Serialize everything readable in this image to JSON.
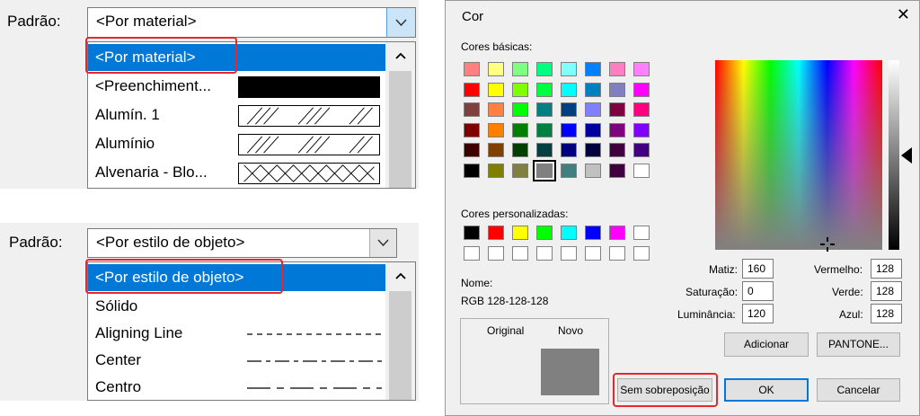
{
  "panel1": {
    "label": "Padrão:",
    "combo_value": "<Por material>",
    "items": [
      {
        "text": "<Por material>",
        "pattern": "none",
        "selected": true
      },
      {
        "text": "<Preenchiment...",
        "pattern": "solid"
      },
      {
        "text": "Alumín. 1",
        "pattern": "diagonal-hatch"
      },
      {
        "text": "Alumínio",
        "pattern": "diagonal-hatch"
      },
      {
        "text": "Alvenaria - Blo...",
        "pattern": "cross-hatch"
      }
    ],
    "scroll_up": "^"
  },
  "panel2": {
    "label": "Padrão:",
    "combo_value": "<Por estilo de objeto>",
    "items": [
      {
        "text": "<Por estilo de objeto>",
        "line": "none",
        "selected": true
      },
      {
        "text": "Sólido",
        "line": "none"
      },
      {
        "text": "Aligning Line",
        "line": "dashed"
      },
      {
        "text": "Center",
        "line": "dash-dot"
      },
      {
        "text": "Centro",
        "line": "long-dash"
      }
    ],
    "scroll_up": "^"
  },
  "dialog": {
    "title": "Cor",
    "close": "✕",
    "basic_colors_label": "Cores básicas:",
    "basic_colors": [
      [
        "#ff8080",
        "#ffff80",
        "#80ff80",
        "#00ff80",
        "#80ffff",
        "#0080ff",
        "#ff80c0",
        "#ff80ff"
      ],
      [
        "#ff0000",
        "#ffff00",
        "#80ff00",
        "#00ff40",
        "#00ffff",
        "#0080c0",
        "#8080c0",
        "#ff00ff"
      ],
      [
        "#804040",
        "#ff8040",
        "#00ff00",
        "#008080",
        "#004080",
        "#8080ff",
        "#800040",
        "#ff0080"
      ],
      [
        "#800000",
        "#ff8000",
        "#008000",
        "#008040",
        "#0000ff",
        "#0000a0",
        "#800080",
        "#8000ff"
      ],
      [
        "#400000",
        "#804000",
        "#004000",
        "#004040",
        "#000080",
        "#000040",
        "#400040",
        "#400080"
      ],
      [
        "#000000",
        "#808000",
        "#808040",
        "#808080",
        "#408080",
        "#c0c0c0",
        "#400040",
        "#ffffff"
      ]
    ],
    "custom_colors_label": "Cores personalizadas:",
    "custom_colors": [
      [
        "#000000",
        "#ff0000",
        "#ffff00",
        "#00ff00",
        "#00ffff",
        "#0000ff",
        "#ff00ff",
        "#ffffff"
      ],
      [
        "#ffffff",
        "#ffffff",
        "#ffffff",
        "#ffffff",
        "#ffffff",
        "#ffffff",
        "#ffffff",
        "#ffffff"
      ]
    ],
    "name_label": "Nome:",
    "name_value": "RGB 128-128-128",
    "original_label": "Original",
    "new_label": "Novo",
    "new_color": "#808080",
    "hue_label": "Matiz:",
    "hue": "160",
    "sat_label": "Saturação:",
    "sat": "0",
    "lum_label": "Luminância:",
    "lum": "120",
    "red_label": "Vermelho:",
    "red": "128",
    "green_label": "Verde:",
    "green": "128",
    "blue_label": "Azul:",
    "blue": "128",
    "add_button": "Adicionar",
    "pantone_button": "PANTONE...",
    "no_overlap_button": "Sem sobreposição",
    "ok_button": "OK",
    "cancel_button": "Cancelar"
  },
  "colors": {
    "selection": "#0078d7",
    "highlight_border": "#e8262b"
  }
}
